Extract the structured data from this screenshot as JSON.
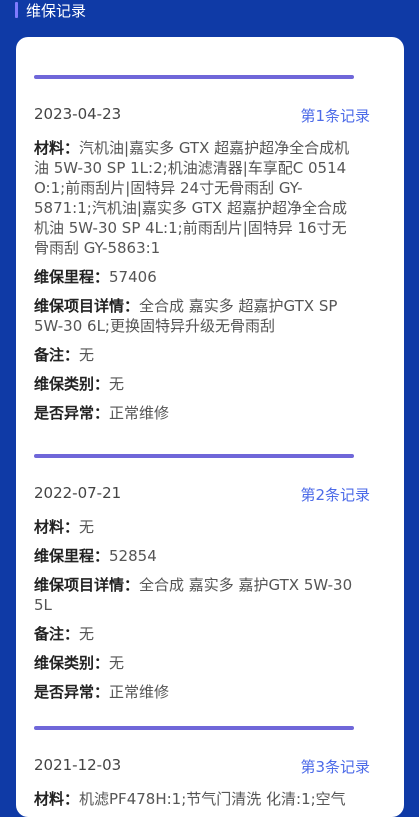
{
  "header": {
    "title": "维保记录"
  },
  "labels": {
    "material": "材料：",
    "mileage": "维保里程：",
    "detail": "维保项目详情：",
    "remark": "备注：",
    "category": "维保类别：",
    "abnormal": "是否异常："
  },
  "records": [
    {
      "date": "2023-04-23",
      "link": "第1条记录",
      "material": "汽机油|嘉实多 GTX 超嘉护超净全合成机油 5W-30 SP 1L:2;机油滤清器|车享配C 0514 O:1;前雨刮片|固特异 24寸无骨雨刮 GY-5871:1;汽机油|嘉实多 GTX 超嘉护超净全合成机油 5W-30 SP 4L:1;前雨刮片|固特异 16寸无骨雨刮 GY-5863:1",
      "mileage": "57406",
      "detail": "全合成 嘉实多 超嘉护GTX SP 5W-30 6L;更换固特异升级无骨雨刮",
      "remark": "无",
      "category": "无",
      "abnormal": "正常维修"
    },
    {
      "date": "2022-07-21",
      "link": "第2条记录",
      "material": "无",
      "mileage": "52854",
      "detail": "全合成 嘉实多 嘉护GTX 5W-30 5L",
      "remark": "无",
      "category": "无",
      "abnormal": "正常维修"
    },
    {
      "date": "2021-12-03",
      "link": "第3条记录",
      "material": "机滤PF478H:1;节气门清洗 化清:1;空气"
    }
  ]
}
